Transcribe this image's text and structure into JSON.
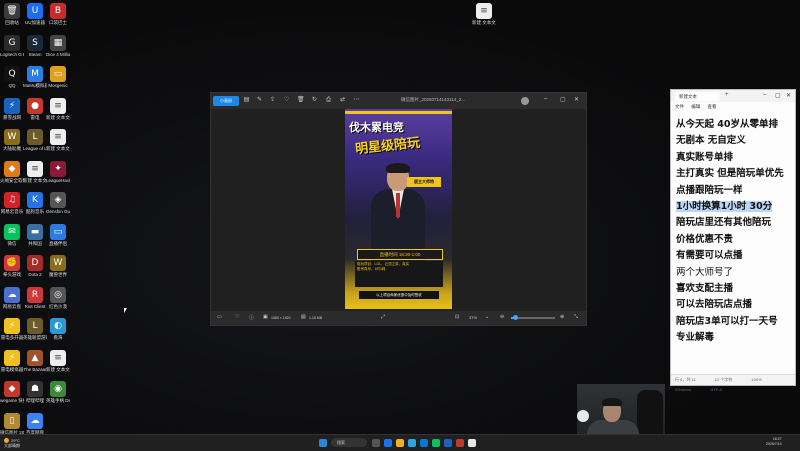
{
  "desktop": {
    "icons": [
      {
        "label": "回收站",
        "glyph": "🗑",
        "color": "#3a3a3a"
      },
      {
        "label": "UU加速器",
        "glyph": "U",
        "color": "#1d6df2"
      },
      {
        "label": "口袋巴士",
        "glyph": "B",
        "color": "#c92b2b"
      },
      {
        "label": "Logitech G HUB",
        "glyph": "G",
        "color": "#2b2b2b"
      },
      {
        "label": "Steam",
        "glyph": "S",
        "color": "#1b2838"
      },
      {
        "label": "Dice 4 Million",
        "glyph": "▦",
        "color": "#444"
      },
      {
        "label": "QQ",
        "glyph": "Q",
        "color": "#111"
      },
      {
        "label": "MuMu模拟器",
        "glyph": "M",
        "color": "#2a7de1"
      },
      {
        "label": "Mosgenic",
        "glyph": "▭",
        "color": "#e0a020"
      },
      {
        "label": "暴雪战网",
        "glyph": "⚡",
        "color": "#1565c0"
      },
      {
        "label": "雷电",
        "glyph": "●",
        "color": "#c0392b"
      },
      {
        "label": "新建 文本文档",
        "glyph": "≡",
        "color": "#eeeeee"
      },
      {
        "label": "大陆助魔",
        "glyph": "W",
        "color": "#8a6d1a"
      },
      {
        "label": "League of Legends",
        "glyph": "L",
        "color": "#6b5a2a"
      },
      {
        "label": "新建 文本文档",
        "glyph": "≡",
        "color": "#eeeeee"
      },
      {
        "label": "火绒安全软件",
        "glyph": "◆",
        "color": "#e07b1a"
      },
      {
        "label": "新建 文本文档",
        "glyph": "≡",
        "color": "#eeeeee"
      },
      {
        "label": "LeagueHack",
        "glyph": "✦",
        "color": "#8b1a3a"
      },
      {
        "label": "网易云音乐",
        "glyph": "♫",
        "color": "#d3222a"
      },
      {
        "label": "酷狗音乐",
        "glyph": "K",
        "color": "#2672e8"
      },
      {
        "label": "Genshin Guardian 2",
        "glyph": "◈",
        "color": "#555"
      },
      {
        "label": "微信",
        "glyph": "✉",
        "color": "#07c160"
      },
      {
        "label": "共和国",
        "glyph": "▬",
        "color": "#3a6ea5"
      },
      {
        "label": "直播伴侣",
        "glyph": "▭",
        "color": "#2b7be0"
      },
      {
        "label": "拳头游戏",
        "glyph": "✊",
        "color": "#d13639"
      },
      {
        "label": "Dota 2",
        "glyph": "D",
        "color": "#a52a2a"
      },
      {
        "label": "魔兽世界",
        "glyph": "W",
        "color": "#8a6d1a"
      },
      {
        "label": "网易云盘",
        "glyph": "☁",
        "color": "#4a6fd0"
      },
      {
        "label": "Riot Client",
        "glyph": "R",
        "color": "#d13639"
      },
      {
        "label": "红色沙漠",
        "glyph": "◎",
        "color": "#555"
      },
      {
        "label": "雷电多开器",
        "glyph": "⚡",
        "color": "#f0c020"
      },
      {
        "label": "英雄联盟游戏",
        "glyph": "L",
        "color": "#6b5a2a"
      },
      {
        "label": "看海",
        "glyph": "◐",
        "color": "#2a9ad6"
      },
      {
        "label": "雷电模拟器",
        "glyph": "⚡",
        "color": "#f0c020"
      },
      {
        "label": "The Bazaar",
        "glyph": "▲",
        "color": "#a0522d"
      },
      {
        "label": "新建 文本文档",
        "glyph": "≡",
        "color": "#eeeeee"
      },
      {
        "label": "wegame 快捷方式",
        "glyph": "◆",
        "color": "#c0392b"
      },
      {
        "label": "哔哩哔哩",
        "glyph": "☗",
        "color": "#333"
      },
      {
        "label": "英雄手柄 Demo",
        "glyph": "◉",
        "color": "#3a8a3a"
      },
      {
        "label": "微信图片 20250711",
        "glyph": "▯",
        "color": "#b08a30"
      },
      {
        "label": "百度网盘",
        "glyph": "☁",
        "color": "#3b82f6"
      },
      {
        "label": "新建 文本文档 (3)",
        "glyph": "≡",
        "color": "#eeeeee"
      }
    ]
  },
  "photo_viewer": {
    "title": "微信图片_20250714143114_2...",
    "tab_label": "小画册",
    "zoom": "37%",
    "size_info": "1080 × 1920",
    "file_size": "1.18 MB",
    "poster": {
      "headline": "伐木累电竞",
      "subheadline": "明星级陪玩",
      "badge": "版主大师特",
      "time": "直播时间  18:30-1:00",
      "info_label": "陪玩项目：LOL、云顶之弈、真实",
      "info_line2": "账号真号、1时1耗",
      "footer": "以上项目商家优惠中及时签收"
    }
  },
  "notepad": {
    "tab_title": "新建文本",
    "menu": [
      "文件",
      "编辑",
      "查看"
    ],
    "lines": [
      "从今天起 40岁从零单排",
      "无剧本 无自定义",
      "真实账号单排",
      "主打真实 但是陪玩单优先",
      "点播跟陪玩一样",
      "1小时换算1小时 30分",
      "陪玩店里还有其他陪玩",
      "价格优惠不贵",
      "有需要可以点播",
      "两个大师号了",
      "喜欢支配主播",
      "可以去陪玩店点播",
      "陪玩店3单可以打一天号",
      "专业解毒"
    ],
    "highlight_line_index": 5,
    "status": [
      "行 6，列 11",
      "12 个字符",
      "100%",
      "Windows",
      "UTF-8"
    ]
  },
  "taskbar": {
    "weather_temp": "29°C",
    "weather_desc": "大部晴朗",
    "search_placeholder": "搜索",
    "time": "18:27",
    "date": "2025/7/14"
  }
}
